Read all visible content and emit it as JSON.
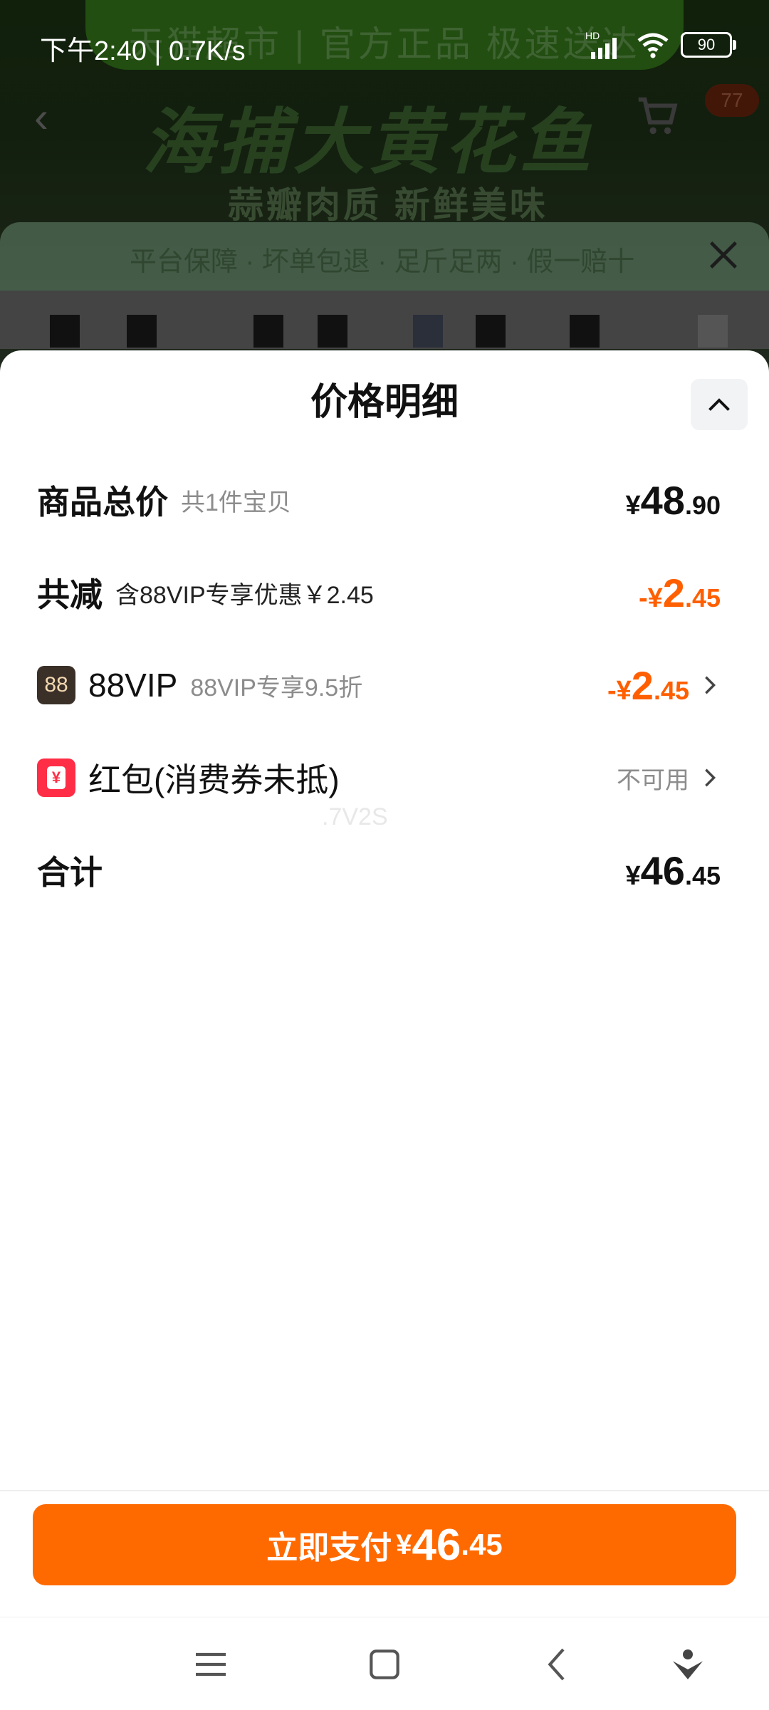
{
  "status_bar": {
    "time": "下午2:40 | 0.7K/s",
    "signal_label": "HD",
    "battery": "90"
  },
  "background": {
    "brand": "天猫超市 | 官方正品 极速送达",
    "headline": "海捕大黄花鱼",
    "subline": "蒜瓣肉质 新鲜美味",
    "cart_badge": "77",
    "guarantee": "平台保障 · 坏单包退 · 足斤足两 · 假一赔十"
  },
  "sheet": {
    "title": "价格明细",
    "rows": [
      {
        "label": "商品总价",
        "sub": "共1件宝贝",
        "price": {
          "yen": "¥",
          "int": "48",
          "dec": ".90"
        }
      },
      {
        "label": "共减",
        "sub": "含88VIP专享优惠￥2.45",
        "price": {
          "yen": "-¥",
          "int": "2",
          "dec": ".45"
        }
      },
      {
        "icon_text": "88",
        "label": "88VIP",
        "sub": "88VIP专享9.5折",
        "price": {
          "yen": "-¥",
          "int": "2",
          "dec": ".45"
        }
      },
      {
        "label": "红包(消费券未抵)",
        "value": "不可用",
        "icon_text": "¥"
      },
      {
        "label": "合计",
        "price": {
          "yen": "¥",
          "int": "46",
          "dec": ".45"
        }
      }
    ],
    "watermark": ".7V2S"
  },
  "pay": {
    "label": "立即支付",
    "yen": "¥",
    "int": "46",
    "dec": ".45"
  },
  "colors": {
    "accent": "#ff6a00",
    "discount": "#ff5f00",
    "redpacket": "#ff2d46",
    "vip_bg": "#3a3028"
  }
}
